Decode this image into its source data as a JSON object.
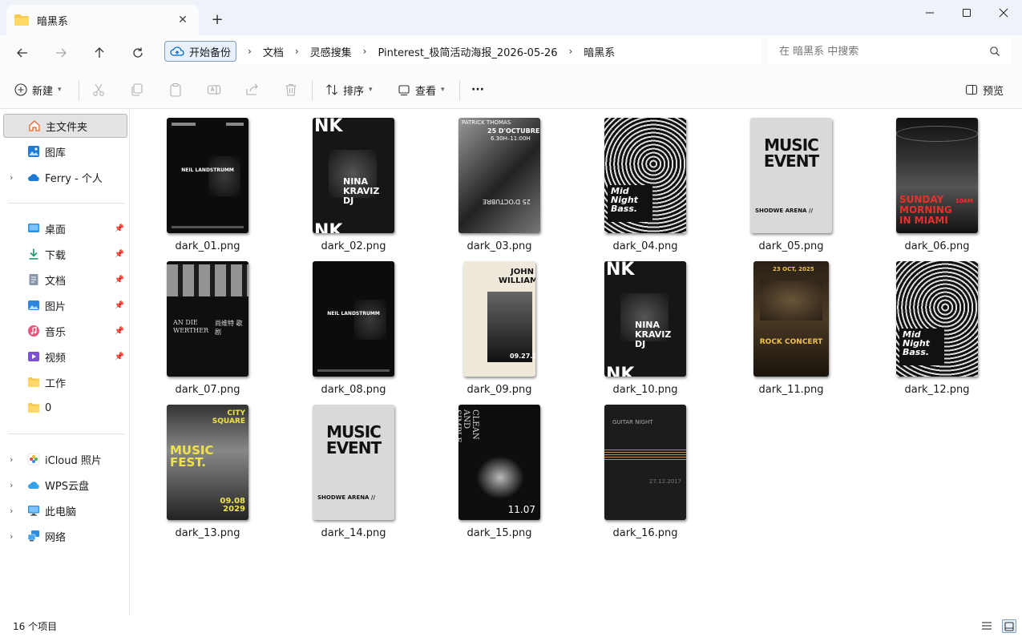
{
  "window": {
    "tab_title": "暗黑系",
    "new_tab_symbol": "+",
    "close_tab_symbol": "✕"
  },
  "address": {
    "home_crumb": "开始备份",
    "crumbs": [
      "文档",
      "灵感搜集",
      "Pinterest_极简活动海报_2026-05-26",
      "暗黑系"
    ],
    "search_placeholder": "在 暗黑系 中搜索"
  },
  "toolbar": {
    "new_label": "新建",
    "sort_label": "排序",
    "view_label": "查看",
    "more_label": "···",
    "preview_label": "预览"
  },
  "sidebar": {
    "items": [
      {
        "label": "主文件夹",
        "icon": "home-icon"
      },
      {
        "label": "图库",
        "icon": "gallery-icon"
      },
      {
        "label": "Ferry - 个人",
        "icon": "onedrive-cloud-icon"
      },
      {
        "label": "桌面",
        "icon": "desktop-icon"
      },
      {
        "label": "下载",
        "icon": "download-icon"
      },
      {
        "label": "文档",
        "icon": "document-icon"
      },
      {
        "label": "图片",
        "icon": "pictures-icon"
      },
      {
        "label": "音乐",
        "icon": "music-icon"
      },
      {
        "label": "视频",
        "icon": "video-icon"
      },
      {
        "label": "工作",
        "icon": "folder-icon"
      },
      {
        "label": "0",
        "icon": "folder-icon"
      },
      {
        "label": "iCloud 照片",
        "icon": "icloud-photos-icon"
      },
      {
        "label": "WPS云盘",
        "icon": "wps-cloud-icon"
      },
      {
        "label": "此电脑",
        "icon": "computer-icon"
      },
      {
        "label": "网络",
        "icon": "network-icon"
      }
    ]
  },
  "files": [
    {
      "name": "dark_01.png",
      "caption": "NEIL LANDSTRUMM"
    },
    {
      "name": "dark_02.png",
      "caption": "NINA KRAVIZ DJ"
    },
    {
      "name": "dark_03.png",
      "caption": "25 D'OCTUBRE"
    },
    {
      "name": "dark_04.png",
      "caption": "Mid Night Bass."
    },
    {
      "name": "dark_05.png",
      "caption": "MUSIC EVENT"
    },
    {
      "name": "dark_06.png",
      "caption": "SUNDAY MORNING IN MIAMI"
    },
    {
      "name": "dark_07.png",
      "caption": "AN DIE WERTHER"
    },
    {
      "name": "dark_08.png",
      "caption": "NEIL LANDSTRUMM"
    },
    {
      "name": "dark_09.png",
      "caption": "JOHN WILLIAMS"
    },
    {
      "name": "dark_10.png",
      "caption": "NINA KRAVIZ DJ"
    },
    {
      "name": "dark_11.png",
      "caption": "ROCK CONCERT"
    },
    {
      "name": "dark_12.png",
      "caption": "Mid Night Bass."
    },
    {
      "name": "dark_13.png",
      "caption": "MUSIC FEST."
    },
    {
      "name": "dark_14.png",
      "caption": "MUSIC EVENT"
    },
    {
      "name": "dark_15.png",
      "caption": "CLEAN AND SIMPLE"
    },
    {
      "name": "dark_16.png",
      "caption": "GUITAR NIGHT"
    }
  ],
  "status": {
    "item_count": "16 个项目"
  },
  "colors": {
    "accent": "#0067c0",
    "folder": "#f8c94b",
    "titlebar": "#eef3f9"
  }
}
